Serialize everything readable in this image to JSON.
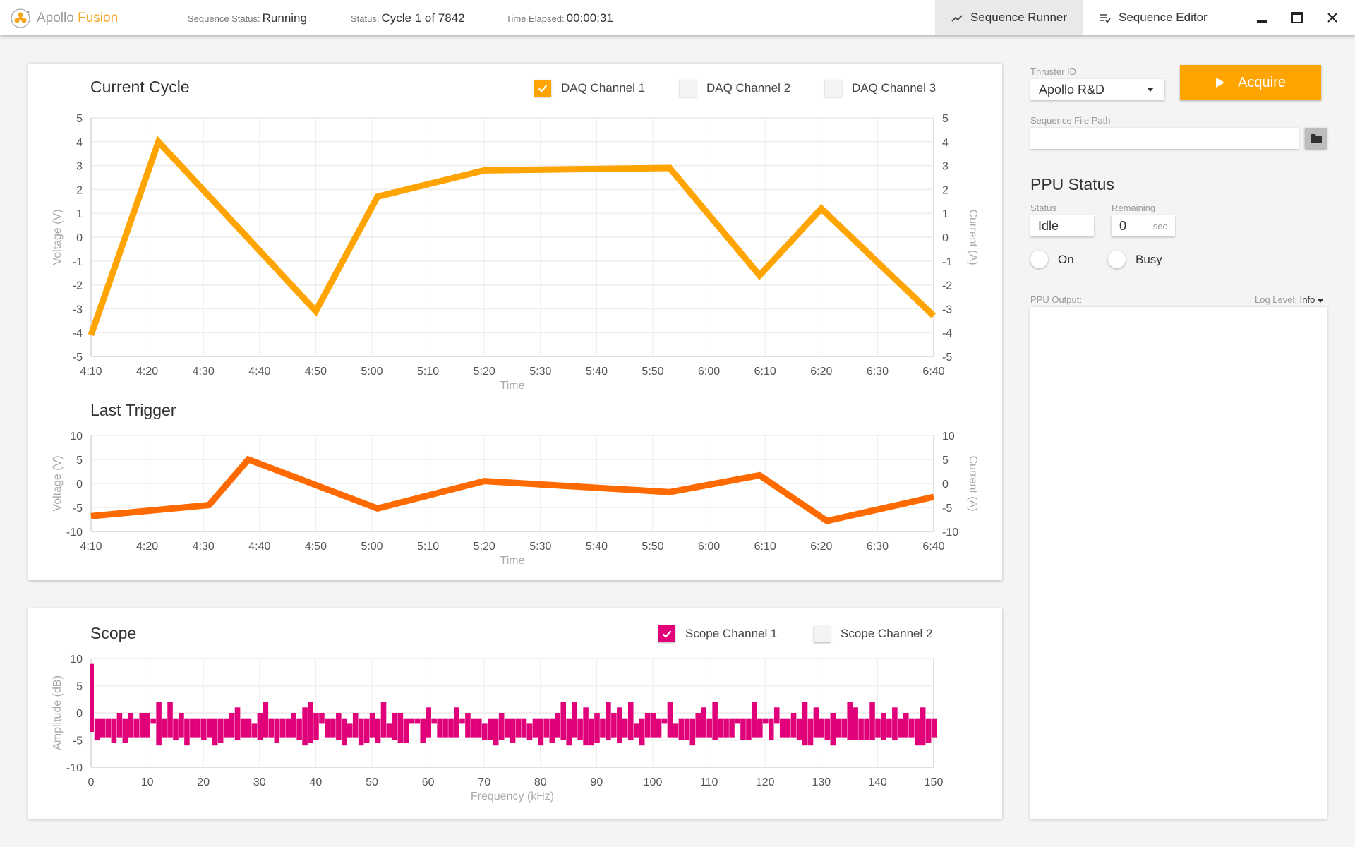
{
  "header": {
    "brand_primary": "Apollo",
    "brand_accent": "Fusion",
    "sequence_status_label": "Sequence Status:",
    "sequence_status_value": "Running",
    "status_label": "Status:",
    "status_value": "Cycle 1 of 7842",
    "time_elapsed_label": "Time Elapsed:",
    "time_elapsed_value": "00:00:31",
    "tabs": [
      {
        "label": "Sequence Runner",
        "icon": "trending-line-icon",
        "active": true
      },
      {
        "label": "Sequence Editor",
        "icon": "list-check-icon",
        "active": false
      }
    ],
    "window_controls": [
      "minimize",
      "maximize",
      "close"
    ]
  },
  "colors": {
    "brand": "#f8a51c",
    "daq1": "#ffa400",
    "trigger": "#ff6a00",
    "scope1": "#e0007a",
    "acquire": "#ffa400"
  },
  "current_cycle": {
    "title": "Current Cycle",
    "channels": [
      {
        "label": "DAQ Channel 1",
        "checked": true
      },
      {
        "label": "DAQ Channel 2",
        "checked": false
      },
      {
        "label": "DAQ Channel 3",
        "checked": false
      }
    ]
  },
  "last_trigger": {
    "title": "Last Trigger"
  },
  "scope": {
    "title": "Scope",
    "channels": [
      {
        "label": "Scope Channel 1",
        "checked": true
      },
      {
        "label": "Scope Channel 2",
        "checked": false
      }
    ]
  },
  "chart_data": [
    {
      "id": "current-cycle",
      "type": "line",
      "title": "Current Cycle",
      "xlabel": "Time",
      "ylabel": "Voltage (V)",
      "y2label": "Current (A)",
      "x_ticks": [
        "4:10",
        "4:20",
        "4:30",
        "4:40",
        "4:50",
        "5:00",
        "5:10",
        "5:20",
        "5:30",
        "5:40",
        "5:50",
        "6:00",
        "6:10",
        "6:20",
        "6:30",
        "6:40"
      ],
      "xlim_minutes": [
        0,
        150
      ],
      "ylim": [
        -5,
        5
      ],
      "y2lim": [
        -5,
        5
      ],
      "y_ticks": [
        5,
        4,
        3,
        2,
        1,
        0,
        -1,
        -2,
        -3,
        -4,
        -5
      ],
      "grid": true,
      "series": [
        {
          "name": "DAQ Channel 1",
          "x_minutes": [
            0,
            12,
            40,
            51,
            70,
            103,
            119,
            130,
            150
          ],
          "values": [
            -4.1,
            4.0,
            -3.1,
            1.7,
            2.8,
            2.9,
            -1.6,
            1.2,
            -3.3
          ]
        }
      ]
    },
    {
      "id": "last-trigger",
      "type": "line",
      "title": "Last Trigger",
      "xlabel": "Time",
      "ylabel": "Voltage (V)",
      "y2label": "Current (A)",
      "x_ticks": [
        "4:10",
        "4:20",
        "4:30",
        "4:40",
        "4:50",
        "5:00",
        "5:10",
        "5:20",
        "5:30",
        "5:40",
        "5:50",
        "6:00",
        "6:10",
        "6:20",
        "6:30",
        "6:40"
      ],
      "xlim_minutes": [
        0,
        150
      ],
      "ylim": [
        -10,
        10
      ],
      "y2lim": [
        -10,
        10
      ],
      "y_ticks": [
        10,
        5,
        0,
        -5,
        -10
      ],
      "grid": true,
      "series": [
        {
          "name": "Trigger",
          "x_minutes": [
            0,
            21,
            28,
            51,
            70,
            103,
            119,
            131,
            150
          ],
          "values": [
            -6.8,
            -4.5,
            5.0,
            -5.2,
            0.5,
            -1.8,
            1.7,
            -7.8,
            -2.8
          ]
        }
      ]
    },
    {
      "id": "scope",
      "type": "bar",
      "title": "Scope",
      "xlabel": "Frequency (kHz)",
      "ylabel": "Amplitude (dB)",
      "x_ticks": [
        0,
        10,
        20,
        30,
        40,
        50,
        60,
        70,
        80,
        90,
        100,
        110,
        120,
        130,
        140,
        150
      ],
      "xlim": [
        0,
        150
      ],
      "ylim": [
        -10,
        10
      ],
      "y_ticks": [
        10,
        5,
        0,
        -5,
        -10
      ],
      "grid": true,
      "series": [
        {
          "name": "Scope Channel 1",
          "description": "range bars (min to max) approx every 1 kHz; DC spike to ~9 dB at 0 kHz; noise floor roughly -4.5 to -1 dB with peaks up to ~2 dB and dips to ~-6 dB",
          "peak_at_0khz": 9,
          "typical_low": -4.5,
          "typical_high": -1
        }
      ]
    }
  ],
  "right_panel": {
    "thruster_label": "Thruster ID",
    "thruster_value": "Apollo R&D",
    "acquire_label": "Acquire",
    "file_path_label": "Sequence File Path",
    "file_path_value": "",
    "ppu_title": "PPU Status",
    "status_label": "Status",
    "status_value": "Idle",
    "remaining_label": "Remaining",
    "remaining_value": "0",
    "remaining_unit": "sec",
    "indicators": [
      {
        "label": "On",
        "on": false
      },
      {
        "label": "Busy",
        "on": false
      }
    ],
    "output_label": "PPU Output:",
    "log_level_label": "Log Level:",
    "log_level_value": "Info",
    "output_text": ""
  }
}
